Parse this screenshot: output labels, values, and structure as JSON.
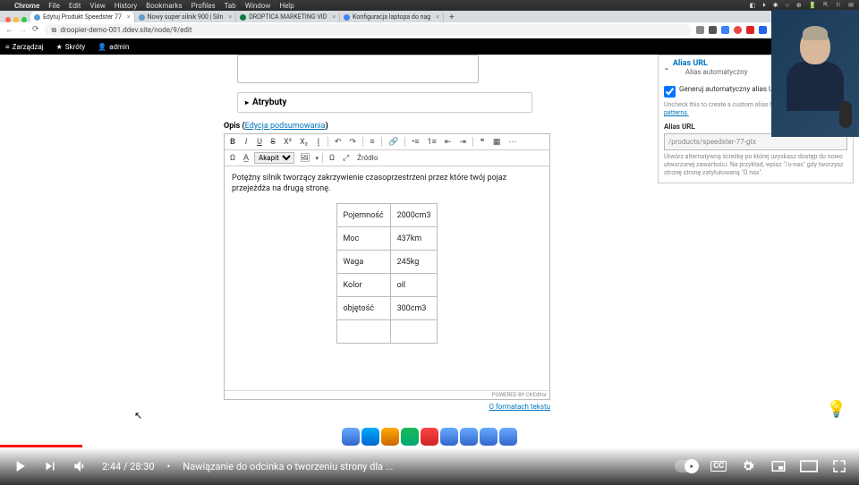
{
  "mac_menu": {
    "app": "Chrome",
    "items": [
      "File",
      "Edit",
      "View",
      "History",
      "Bookmarks",
      "Profiles",
      "Tab",
      "Window",
      "Help"
    ],
    "right": [
      "◧",
      "⏵",
      "✱",
      "○",
      "⊕",
      "🔋",
      "ᴾᴸ",
      "⚐",
      "✉"
    ]
  },
  "tabs": [
    {
      "label": "Edytuj Produkt Speedster 77"
    },
    {
      "label": "Nowy super silnik 900 | Siln"
    },
    {
      "label": "DROPTICA MARKETING VID"
    },
    {
      "label": "Konfiguracja laptopa do nag"
    }
  ],
  "url": "droopier-demo-001.ddev.site/node/9/edit",
  "admin": {
    "manage": "Zarządzaj",
    "shortcuts": "Skróty",
    "user": "admin"
  },
  "attributes_summary": "Atrybuty",
  "opis": {
    "label": "Opis",
    "edit_summary": "Edycja podsumowania"
  },
  "toolbar": {
    "bold": "B",
    "italic": "I",
    "underline": "U",
    "strike": "S",
    "super": "X²",
    "sub": "X₂",
    "clear": "I͓",
    "undo": "↶",
    "redo": "↷",
    "align": "≡",
    "justify": "≣",
    "link": "🔗",
    "ul": "•≡",
    "ol": "1≡",
    "indent": "⇥",
    "outdent": "⇤",
    "quote": "❝",
    "table": "▦",
    "more": "⋯",
    "omega": "Ω",
    "format_select": "Akapit",
    "image": "🖼",
    "media": "⊞",
    "oembed": "Ω",
    "full": "⤢",
    "source": "Źródło"
  },
  "body_text": "Potężny silnik tworzący zakrzywienie czasoprzestrzeni przez które twój pojaz przejeżdża na drugą stronę.",
  "spec_table": [
    [
      "Pojemność",
      "2000cm3"
    ],
    [
      "Moc",
      "437km"
    ],
    [
      "Waga",
      "245kg"
    ],
    [
      "Kolor",
      "oil"
    ],
    [
      "objętość",
      "300cm3"
    ],
    [
      "",
      ""
    ]
  ],
  "powered": "POWERED BY CKEditor",
  "formats_link": "O formatach tekstu",
  "sidebar": {
    "alias_title": "Alias URL",
    "alias_sub": "Alias automatyczny",
    "checkbox_label": "Generuj automatyczny alias URL",
    "checkbox_hint_1": "Uncheck this to create a custom alias belo",
    "checkbox_hint_link": "patterns.",
    "field_label": "Alias URL",
    "field_value": "/products/speedster-77-gtx",
    "field_hint": "Utwórz alternatywną ścieżkę po której uzyskasz dostęp do nowo utworzonej zawartości. Na przykład, wpisz \"/o-nas\" gdy tworzysz stronę stronę zatytułowaną \"O nas\"."
  },
  "player": {
    "time_current": "2:44",
    "time_total": "28:30",
    "title": "Nawiązanie do odcinka o tworzeniu strony dla ...",
    "cc": "CC"
  }
}
